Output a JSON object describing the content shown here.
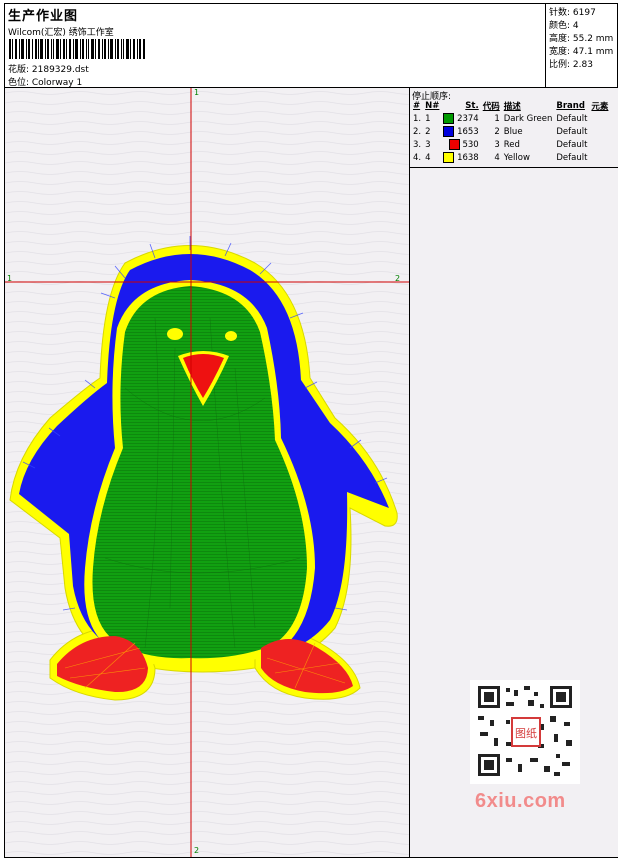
{
  "header": {
    "title": "生产作业图",
    "company": "Wilcom(汇宏) 绣饰工作室",
    "design_label": "花版: 2189329.dst",
    "colorway_label": "色位: Colorway 1"
  },
  "stats": [
    {
      "text": "针数: 6197"
    },
    {
      "text": "颜色: 4"
    },
    {
      "text": "高度: 55.2 mm"
    },
    {
      "text": "宽度: 47.1 mm"
    },
    {
      "text": "比例: 2.83"
    }
  ],
  "canvas": {
    "background": "#f2f0f3",
    "crosshair_color": "#d00000",
    "axis_labels": {
      "v_top": "1",
      "v_bottom": "2",
      "h_left": "1",
      "h_right": "2"
    }
  },
  "stop_sequence": {
    "title": "停止顺序:",
    "headers": [
      "#",
      "N#",
      "St.",
      "代码",
      "描述",
      "Brand",
      "元素"
    ],
    "rows": [
      {
        "num": "1.",
        "n": "1",
        "color": "#009900",
        "stitches": "2374",
        "code": "1",
        "desc": "Dark Green",
        "brand": "Default"
      },
      {
        "num": "2.",
        "n": "2",
        "color": "#0000dd",
        "stitches": "1653",
        "code": "2",
        "desc": "Blue",
        "brand": "Default"
      },
      {
        "num": "3.",
        "n": "3",
        "color": "#ee0000",
        "stitches": "530",
        "code": "3",
        "desc": "Red",
        "brand": "Default"
      },
      {
        "num": "4.",
        "n": "4",
        "color": "#ffff00",
        "stitches": "1638",
        "code": "4",
        "desc": "Yellow",
        "brand": "Default"
      }
    ]
  },
  "watermark": {
    "text": "6xiu.com",
    "seal": "图纸"
  }
}
